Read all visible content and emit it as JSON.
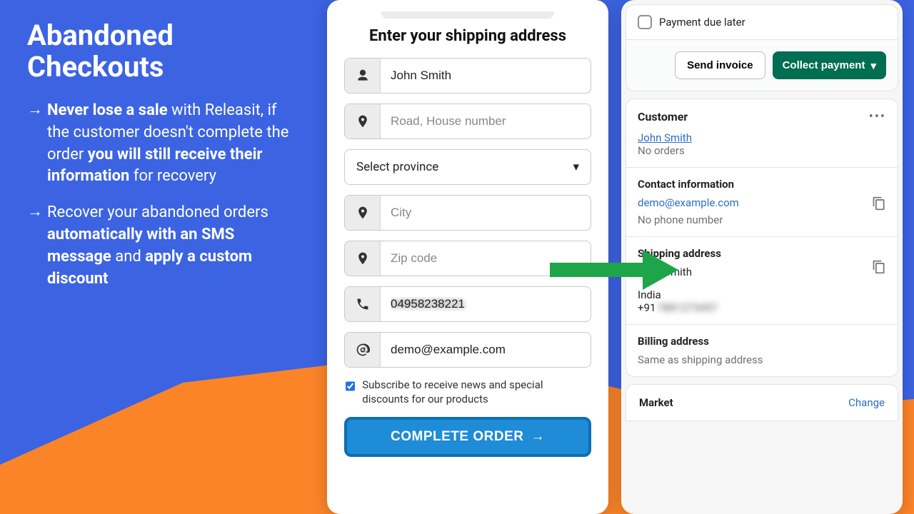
{
  "left": {
    "title": "Abandoned Checkouts",
    "bullet1_a": "Never lose a sale",
    "bullet1_b": " with Releasit, if the customer doesn't complete the order ",
    "bullet1_c": "you will still receive their information",
    "bullet1_d": " for recovery",
    "bullet2_a": "Recover your abandoned orders ",
    "bullet2_b": "automatically with an SMS message",
    "bullet2_c": " and ",
    "bullet2_d": "apply a custom discount"
  },
  "form": {
    "title": "Enter your shipping address",
    "name_value": "John Smith",
    "road_ph": "Road, House number",
    "province": "Select province",
    "city_ph": "City",
    "zip_ph": "Zip code",
    "phone_value": "04958238221",
    "email_value": "demo@example.com",
    "subscribe": "Subscribe to receive news and special discounts for our products",
    "submit": "COMPLETE ORDER"
  },
  "admin": {
    "pay_later": "Payment due later",
    "send_invoice": "Send invoice",
    "collect_payment": "Collect payment",
    "customer_head": "Customer",
    "customer_name": "John Smith",
    "customer_orders": "No orders",
    "contact_head": "Contact information",
    "contact_email": "demo@example.com",
    "contact_phone_hint": "No phone number",
    "ship_head": "Shipping address",
    "ship_name": "John Smith",
    "ship_country": "India",
    "ship_phone": "+91 7881273457",
    "bill_head": "Billing address",
    "bill_same": "Same as shipping address",
    "market_head": "Market",
    "change": "Change"
  }
}
